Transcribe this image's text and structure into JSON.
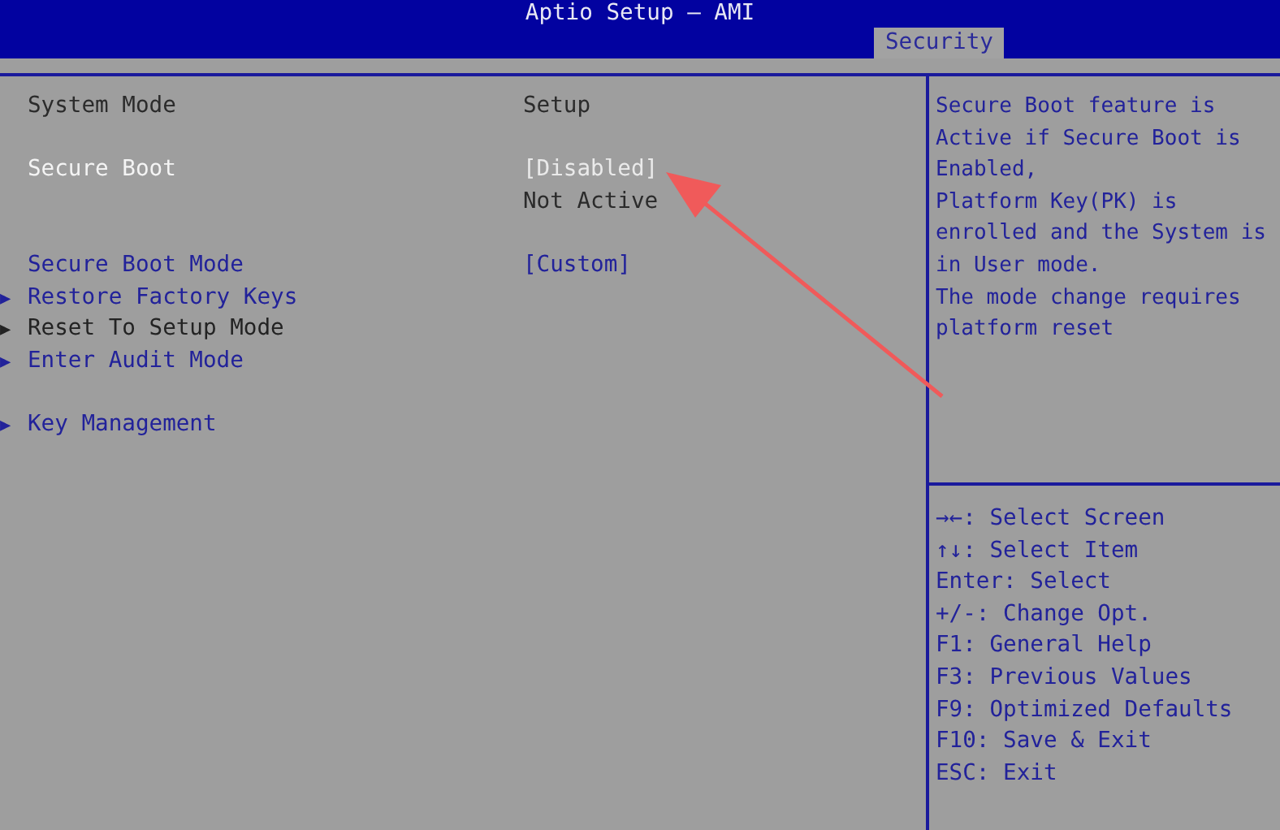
{
  "window": {
    "title": "Aptio Setup – AMI"
  },
  "tabs": [
    {
      "label": "Security",
      "selected": true
    }
  ],
  "groups": [
    [
      {
        "kind": "info",
        "label": "System Mode",
        "value": "Setup",
        "selected": false
      }
    ],
    [
      {
        "kind": "option",
        "label": "Secure Boot",
        "value": "[Disabled]",
        "status": "Not Active",
        "selected": true
      }
    ],
    [
      {
        "kind": "option",
        "label": "Secure Boot Mode",
        "value": "[Custom]",
        "selected": false,
        "disabled": false
      },
      {
        "kind": "submenu",
        "marker": "▶",
        "label": "Restore Factory Keys",
        "selected": false,
        "disabled": false
      },
      {
        "kind": "submenu",
        "marker": "▶",
        "label": "Reset To Setup Mode",
        "selected": false,
        "disabled": true
      },
      {
        "kind": "submenu",
        "marker": "▶",
        "label": "Enter Audit Mode",
        "selected": false,
        "disabled": false
      }
    ],
    [
      {
        "kind": "submenu",
        "marker": "▶",
        "label": "Key Management",
        "selected": false,
        "disabled": false
      }
    ]
  ],
  "help_lines": [
    "Secure Boot feature is",
    "Active if Secure Boot is",
    "Enabled,",
    "Platform Key(PK) is",
    "enrolled and the System is",
    "in User mode.",
    "The mode change requires",
    "platform reset"
  ],
  "keys": [
    "→←: Select Screen",
    "↑↓: Select Item",
    "Enter: Select",
    "+/-: Change Opt.",
    "F1: General Help",
    "F3: Previous Values",
    "F9: Optimized Defaults",
    "F10: Save & Exit",
    "ESC: Exit"
  ]
}
